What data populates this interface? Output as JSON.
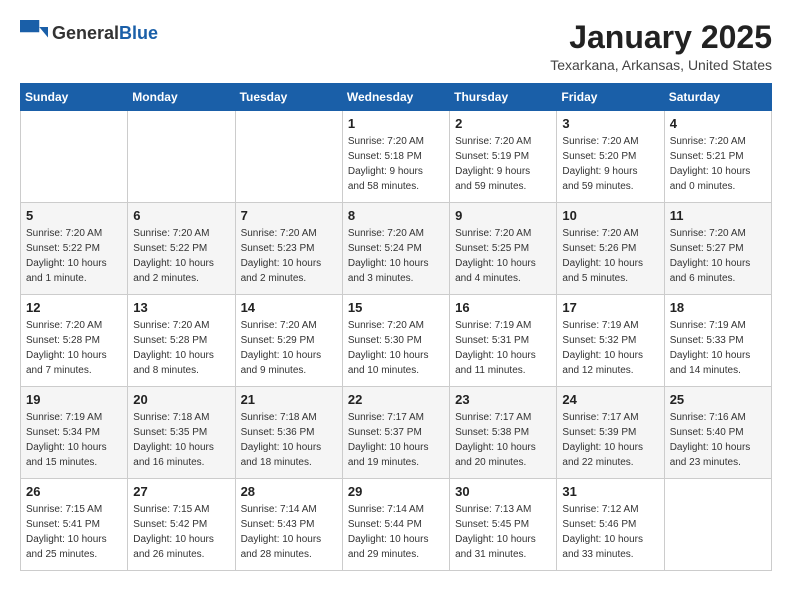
{
  "logo": {
    "text_general": "General",
    "text_blue": "Blue"
  },
  "header": {
    "month": "January 2025",
    "location": "Texarkana, Arkansas, United States"
  },
  "days_of_week": [
    "Sunday",
    "Monday",
    "Tuesday",
    "Wednesday",
    "Thursday",
    "Friday",
    "Saturday"
  ],
  "weeks": [
    [
      {
        "day": "",
        "info": ""
      },
      {
        "day": "",
        "info": ""
      },
      {
        "day": "",
        "info": ""
      },
      {
        "day": "1",
        "info": "Sunrise: 7:20 AM\nSunset: 5:18 PM\nDaylight: 9 hours\nand 58 minutes."
      },
      {
        "day": "2",
        "info": "Sunrise: 7:20 AM\nSunset: 5:19 PM\nDaylight: 9 hours\nand 59 minutes."
      },
      {
        "day": "3",
        "info": "Sunrise: 7:20 AM\nSunset: 5:20 PM\nDaylight: 9 hours\nand 59 minutes."
      },
      {
        "day": "4",
        "info": "Sunrise: 7:20 AM\nSunset: 5:21 PM\nDaylight: 10 hours\nand 0 minutes."
      }
    ],
    [
      {
        "day": "5",
        "info": "Sunrise: 7:20 AM\nSunset: 5:22 PM\nDaylight: 10 hours\nand 1 minute."
      },
      {
        "day": "6",
        "info": "Sunrise: 7:20 AM\nSunset: 5:22 PM\nDaylight: 10 hours\nand 2 minutes."
      },
      {
        "day": "7",
        "info": "Sunrise: 7:20 AM\nSunset: 5:23 PM\nDaylight: 10 hours\nand 2 minutes."
      },
      {
        "day": "8",
        "info": "Sunrise: 7:20 AM\nSunset: 5:24 PM\nDaylight: 10 hours\nand 3 minutes."
      },
      {
        "day": "9",
        "info": "Sunrise: 7:20 AM\nSunset: 5:25 PM\nDaylight: 10 hours\nand 4 minutes."
      },
      {
        "day": "10",
        "info": "Sunrise: 7:20 AM\nSunset: 5:26 PM\nDaylight: 10 hours\nand 5 minutes."
      },
      {
        "day": "11",
        "info": "Sunrise: 7:20 AM\nSunset: 5:27 PM\nDaylight: 10 hours\nand 6 minutes."
      }
    ],
    [
      {
        "day": "12",
        "info": "Sunrise: 7:20 AM\nSunset: 5:28 PM\nDaylight: 10 hours\nand 7 minutes."
      },
      {
        "day": "13",
        "info": "Sunrise: 7:20 AM\nSunset: 5:28 PM\nDaylight: 10 hours\nand 8 minutes."
      },
      {
        "day": "14",
        "info": "Sunrise: 7:20 AM\nSunset: 5:29 PM\nDaylight: 10 hours\nand 9 minutes."
      },
      {
        "day": "15",
        "info": "Sunrise: 7:20 AM\nSunset: 5:30 PM\nDaylight: 10 hours\nand 10 minutes."
      },
      {
        "day": "16",
        "info": "Sunrise: 7:19 AM\nSunset: 5:31 PM\nDaylight: 10 hours\nand 11 minutes."
      },
      {
        "day": "17",
        "info": "Sunrise: 7:19 AM\nSunset: 5:32 PM\nDaylight: 10 hours\nand 12 minutes."
      },
      {
        "day": "18",
        "info": "Sunrise: 7:19 AM\nSunset: 5:33 PM\nDaylight: 10 hours\nand 14 minutes."
      }
    ],
    [
      {
        "day": "19",
        "info": "Sunrise: 7:19 AM\nSunset: 5:34 PM\nDaylight: 10 hours\nand 15 minutes."
      },
      {
        "day": "20",
        "info": "Sunrise: 7:18 AM\nSunset: 5:35 PM\nDaylight: 10 hours\nand 16 minutes."
      },
      {
        "day": "21",
        "info": "Sunrise: 7:18 AM\nSunset: 5:36 PM\nDaylight: 10 hours\nand 18 minutes."
      },
      {
        "day": "22",
        "info": "Sunrise: 7:17 AM\nSunset: 5:37 PM\nDaylight: 10 hours\nand 19 minutes."
      },
      {
        "day": "23",
        "info": "Sunrise: 7:17 AM\nSunset: 5:38 PM\nDaylight: 10 hours\nand 20 minutes."
      },
      {
        "day": "24",
        "info": "Sunrise: 7:17 AM\nSunset: 5:39 PM\nDaylight: 10 hours\nand 22 minutes."
      },
      {
        "day": "25",
        "info": "Sunrise: 7:16 AM\nSunset: 5:40 PM\nDaylight: 10 hours\nand 23 minutes."
      }
    ],
    [
      {
        "day": "26",
        "info": "Sunrise: 7:15 AM\nSunset: 5:41 PM\nDaylight: 10 hours\nand 25 minutes."
      },
      {
        "day": "27",
        "info": "Sunrise: 7:15 AM\nSunset: 5:42 PM\nDaylight: 10 hours\nand 26 minutes."
      },
      {
        "day": "28",
        "info": "Sunrise: 7:14 AM\nSunset: 5:43 PM\nDaylight: 10 hours\nand 28 minutes."
      },
      {
        "day": "29",
        "info": "Sunrise: 7:14 AM\nSunset: 5:44 PM\nDaylight: 10 hours\nand 29 minutes."
      },
      {
        "day": "30",
        "info": "Sunrise: 7:13 AM\nSunset: 5:45 PM\nDaylight: 10 hours\nand 31 minutes."
      },
      {
        "day": "31",
        "info": "Sunrise: 7:12 AM\nSunset: 5:46 PM\nDaylight: 10 hours\nand 33 minutes."
      },
      {
        "day": "",
        "info": ""
      }
    ]
  ]
}
